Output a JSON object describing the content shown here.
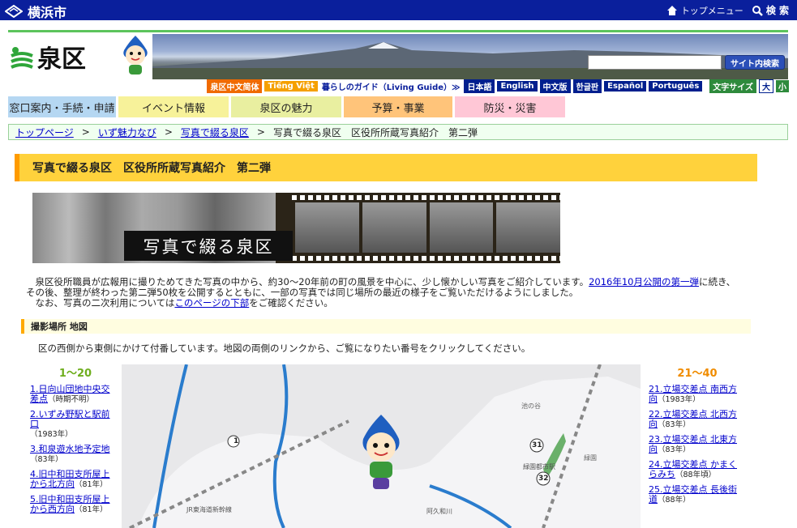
{
  "topbar": {
    "city_name": "横浜市",
    "top_menu": "トップメニュー",
    "search": "検 索"
  },
  "header": {
    "ward_name": "泉区",
    "search_placeholder": "",
    "search_button": "サイト内検索"
  },
  "langbar": {
    "items": [
      "泉区中文简体",
      "Tiếng Việt",
      "暮らしのガイド（Living Guide）≫",
      "日本語",
      "English",
      "中文版",
      "한글판",
      "Español",
      "Português"
    ],
    "font_size_label": "文字サイズ",
    "font_large": "大",
    "font_small": "小"
  },
  "mainnav": {
    "tabs": [
      {
        "label": "窓口案内・手続・申請",
        "color": "#b5d7f2"
      },
      {
        "label": "イベント情報",
        "color": "#f7f29a"
      },
      {
        "label": "泉区の魅力",
        "color": "#e9efa0"
      },
      {
        "label": "予算・事業",
        "color": "#ffc47a"
      },
      {
        "label": "防災・災害",
        "color": "#ffc7d6"
      }
    ]
  },
  "breadcrumb": {
    "items": [
      "トップページ",
      "いず魅力なび",
      "写真で綴る泉区",
      "写真で綴る泉区　区役所所蔵写真紹介　第二弾"
    ],
    "sep": ">"
  },
  "page": {
    "title": "写真で綴る泉区　区役所所蔵写真紹介　第二弾",
    "banner_caption": "写真で綴る泉区"
  },
  "intro": {
    "line1_pre": "　泉区役所職員が広報用に撮りためてきた写真の中から、約30～20年前の町の風景を中心に、少し懐かしい写真をご紹介しています。",
    "line1_link": "2016年10月公開の第一弾",
    "line1_post": "に続き、",
    "line2": "その後、整理が終わった第二弾50枚を公開するとともに、一部の写真では同じ場所の最近の様子をご覧いただけるようにしました。",
    "line3_pre": "　なお、写真の二次利用については",
    "line3_link": "このページの下部",
    "line3_post": "をご確認ください。"
  },
  "section": {
    "head": "撮影場所 地図",
    "text": "区の西側から東側にかけて付番しています。地図の両側のリンクから、ご覧になりたい番号をクリックしてください。"
  },
  "map": {
    "labels": [
      "池の谷",
      "緑園都市駅",
      "緑園",
      "JR東海道新幹線",
      "阿久和川"
    ],
    "markers": [
      "1",
      "31",
      "32"
    ]
  },
  "left_list": {
    "head": "1～20",
    "items": [
      {
        "line1": "1.日向山団地中央交",
        "line2": "差点",
        "date": "（時期不明）"
      },
      {
        "line1": "2.いずみ野駅と駅前",
        "line2": "口",
        "date": "（1983年）"
      },
      {
        "line1": "3.和泉遊水地予定地",
        "line2": "",
        "date": "（83年）"
      },
      {
        "line1": "4.旧中和田支所屋上",
        "line2": "から北方向",
        "date": "（81年）"
      },
      {
        "line1": "5.旧中和田支所屋上",
        "line2": "から西方向",
        "date": "（81年）"
      }
    ]
  },
  "right_list": {
    "head": "21～40",
    "items": [
      {
        "line1": "21.立場交差点 南西方",
        "line2": "向",
        "date": "（1983年）"
      },
      {
        "line1": "22.立場交差点 北西方",
        "line2": "向",
        "date": "（83年）"
      },
      {
        "line1": "23.立場交差点 北東方",
        "line2": "向",
        "date": "（83年）"
      },
      {
        "line1": "24.立場交差点 かまく",
        "line2": "らみち",
        "date": "（88年頃）"
      },
      {
        "line1": "25.立場交差点 長後街",
        "line2": "道",
        "date": "（88年）"
      }
    ]
  },
  "colors": {
    "topbar": "#0a1f9c",
    "title_bg": "#ffd23c",
    "left_head": "#6fae1e",
    "right_head": "#f08c00"
  }
}
